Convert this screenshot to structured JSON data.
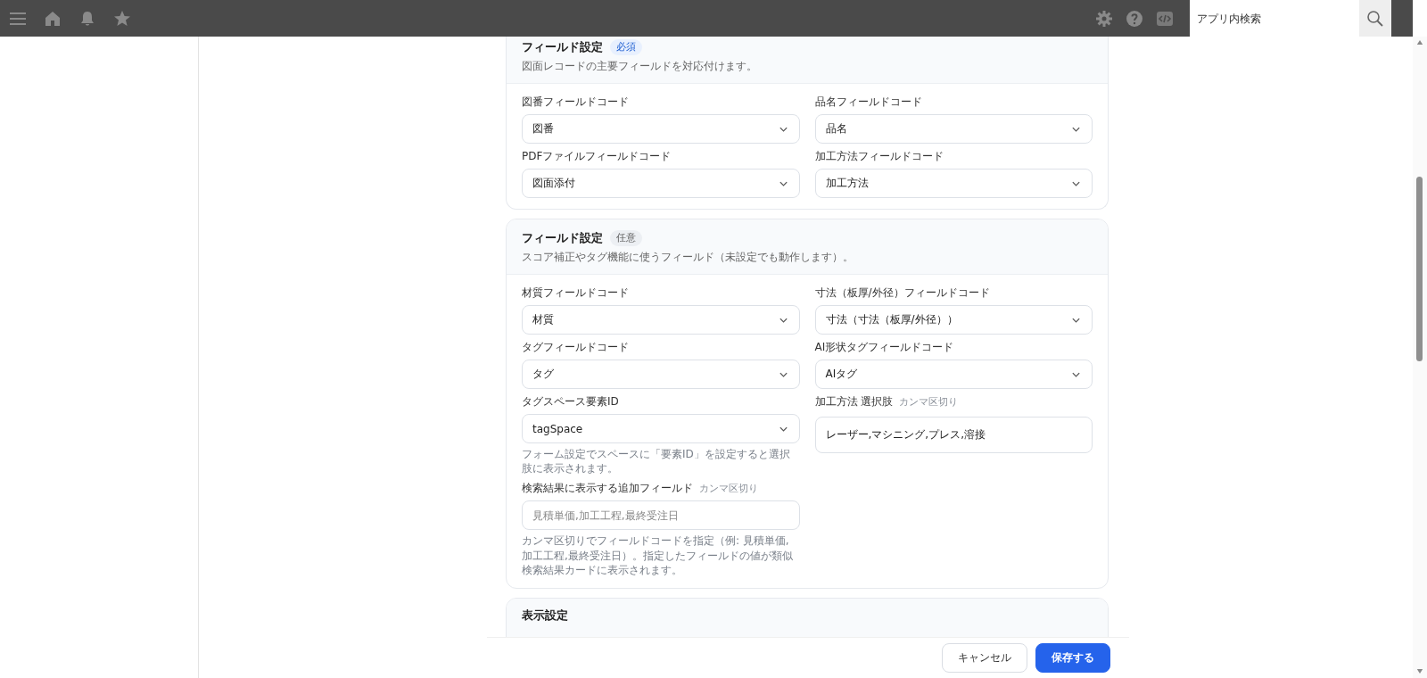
{
  "topbar": {
    "search": {
      "placeholder": "アプリ内検索"
    }
  },
  "sections": [
    {
      "title": "フィールド設定",
      "badge": {
        "text": "必須",
        "kind": "required"
      },
      "description": "図面レコードの主要フィールドを対応付けます。",
      "fields": [
        {
          "kind": "select",
          "label": "図番フィールドコード",
          "value": "図番"
        },
        {
          "kind": "select",
          "label": "品名フィールドコード",
          "value": "品名"
        },
        {
          "kind": "select",
          "label": "PDFファイルフィールドコード",
          "value": "図面添付"
        },
        {
          "kind": "select",
          "label": "加工方法フィールドコード",
          "value": "加工方法"
        }
      ]
    },
    {
      "title": "フィールド設定",
      "badge": {
        "text": "任意",
        "kind": "optional"
      },
      "description": "スコア補正やタグ機能に使うフィールド（未設定でも動作します）。",
      "fields": [
        {
          "kind": "select",
          "label": "材質フィールドコード",
          "value": "材質"
        },
        {
          "kind": "select",
          "label": "寸法（板厚/外径）フィールドコード",
          "value": "寸法（寸法（板厚/外径））"
        },
        {
          "kind": "select",
          "label": "タグフィールドコード",
          "value": "タグ"
        },
        {
          "kind": "select",
          "label": "AI形状タグフィールドコード",
          "value": "AIタグ"
        },
        {
          "kind": "select",
          "label": "タグスペース要素ID",
          "value": "tagSpace",
          "help": "フォーム設定でスペースに「要素ID」を設定すると選択肢に表示されます。"
        },
        {
          "kind": "textarea",
          "label": "加工方法 選択肢",
          "hint": "カンマ区切り",
          "value": "レーザー,マシニング,プレス,溶接"
        },
        {
          "kind": "text",
          "label": "検索結果に表示する追加フィールド",
          "hint": "カンマ区切り",
          "placeholder": "見積単価,加工工程,最終受注日",
          "help": "カンマ区切りでフィールドコードを指定（例: 見積単価,加工工程,最終受注日）。指定したフィールドの値が類似検索結果カードに表示されます。"
        }
      ]
    },
    {
      "title": "表示設定"
    }
  ],
  "footer": {
    "buttons": [
      {
        "label": "キャンセル",
        "kind": "secondary"
      },
      {
        "label": "保存する",
        "kind": "primary"
      }
    ]
  }
}
